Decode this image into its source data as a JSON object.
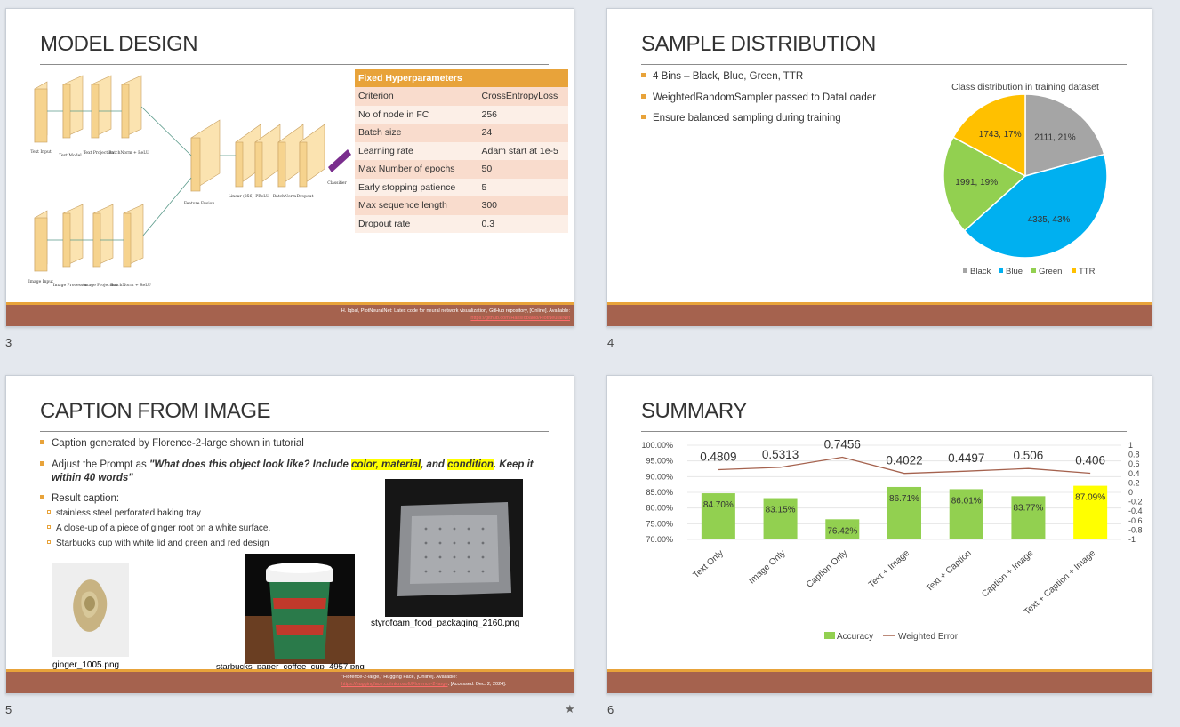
{
  "slides": {
    "s3": {
      "title": "MODEL DESIGN",
      "number": "3",
      "table": {
        "header": "Fixed Hyperparameters",
        "rows": [
          {
            "k": "Criterion",
            "v": "CrossEntropyLoss"
          },
          {
            "k": "No of node in FC",
            "v": "256"
          },
          {
            "k": "Batch size",
            "v": "24"
          },
          {
            "k": "Learning rate",
            "v": "Adam start at 1e-5"
          },
          {
            "k": "Max Number of epochs",
            "v": "50"
          },
          {
            "k": "Early stopping patience",
            "v": "5"
          },
          {
            "k": "Max sequence length",
            "v": "300"
          },
          {
            "k": "Dropout rate",
            "v": "0.3"
          }
        ]
      },
      "diagram_labels": {
        "text_input": "Text Input",
        "text_model": "Text Model",
        "text_proj": "Text Projection",
        "batchnorm_top": "BatchNorm + ReLU",
        "image_input": "Image Input",
        "image_proc": "Image Processor",
        "image_proj": "Image Projection",
        "batchnorm_bottom": "BatchNorm + ReLU",
        "feature_fusion": "Feature Fusion",
        "linear": "Linear (256)",
        "prelu": "PReLU",
        "batchnorm_mid": "BatchNorm",
        "dropout": "Dropout",
        "classifier": "Classifier"
      },
      "footnote": "H. Iqbal, PlotNeuralNet: Latex code for neural network visualization, GitHub repository, [Online]. Available:",
      "footnote_link": "https://github.com/HarisIqbal88/PlotNeuralNet"
    },
    "s4": {
      "title": "SAMPLE DISTRIBUTION",
      "number": "4",
      "bullets": [
        "4 Bins – Black, Blue, Green, TTR",
        "WeightedRandomSampler passed to DataLoader",
        "Ensure balanced sampling during training"
      ]
    },
    "s5": {
      "title": "CAPTION FROM IMAGE",
      "number": "5",
      "bullet1": "Caption generated by Florence-2-large shown in tutorial",
      "bullet2_prefix": "Adjust the Prompt as ",
      "prompt_a": "\"What does this object look like? Include ",
      "prompt_color": "color, material",
      "prompt_b": ", and ",
      "prompt_condition": "condition",
      "prompt_c": ". Keep it",
      "prompt_line2": "within 40 words\"",
      "bullet3": "Result caption:",
      "captions": [
        "stainless steel perforated baking tray",
        "A close-up of a piece of ginger root on a white surface.",
        "Starbucks cup with white lid and green and red design"
      ],
      "images": {
        "ginger": "ginger_1005.png",
        "starbucks": "starbucks_paper_coffee_cup_4957.png",
        "tray": "styrofoam_food_packaging_2160.png"
      },
      "footnote": "\"Florence-2-large,\" Hugging Face, [Online]. Available:",
      "footnote_link": "https://huggingface.co/microsoft/Florence-2-large",
      "footnote_tail": ". [Accessed: Dec. 2, 2024].",
      "star": "★"
    },
    "s6": {
      "title": "SUMMARY",
      "number": "6"
    }
  },
  "chart_data": [
    {
      "type": "pie",
      "title": "Class distribution in training dataset",
      "categories": [
        "Black",
        "Blue",
        "Green",
        "TTR"
      ],
      "values": [
        2111,
        4335,
        1991,
        1743
      ],
      "percent_labels": [
        "2111, 21%",
        "4335, 43%",
        "1991, 19%",
        "1743, 17%"
      ],
      "colors": [
        "#a5a5a5",
        "#00b0f0",
        "#92d050",
        "#ffc000"
      ],
      "legend": "bottom"
    },
    {
      "type": "bar",
      "categories": [
        "Text Only",
        "Image Only",
        "Caption Only",
        "Text + Image",
        "Text + Caption",
        "Caption + Image",
        "Text + Caption + Image"
      ],
      "series": [
        {
          "name": "Accuracy",
          "values": [
            84.7,
            83.15,
            76.42,
            86.71,
            86.01,
            83.77,
            87.09
          ],
          "labels": [
            "84.70%",
            "83.15%",
            "76.42%",
            "86.71%",
            "86.01%",
            "83.77%",
            "87.09%"
          ],
          "color": "#92d050",
          "highlight_color": "#ffff00",
          "highlight_index": 6
        },
        {
          "name": "Weighted Error",
          "type": "line",
          "values": [
            0.4809,
            0.5313,
            0.7456,
            0.4022,
            0.4497,
            0.506,
            0.406
          ],
          "labels": [
            "0.4809",
            "0.5313",
            "0.7456",
            "0.4022",
            "0.4497",
            "0.506",
            "0.406"
          ],
          "color": "#a5624e",
          "axis": "secondary"
        }
      ],
      "ylim": [
        70,
        100
      ],
      "yticks": [
        "100.00%",
        "95.00%",
        "90.00%",
        "85.00%",
        "80.00%",
        "75.00%",
        "70.00%"
      ],
      "y2lim": [
        -1,
        1
      ],
      "y2ticks": [
        "1",
        "0.8",
        "0.6",
        "0.4",
        "0.2",
        "0",
        "-0.2",
        "-0.4",
        "-0.6",
        "-0.8",
        "-1"
      ],
      "legend": "bottom"
    }
  ]
}
